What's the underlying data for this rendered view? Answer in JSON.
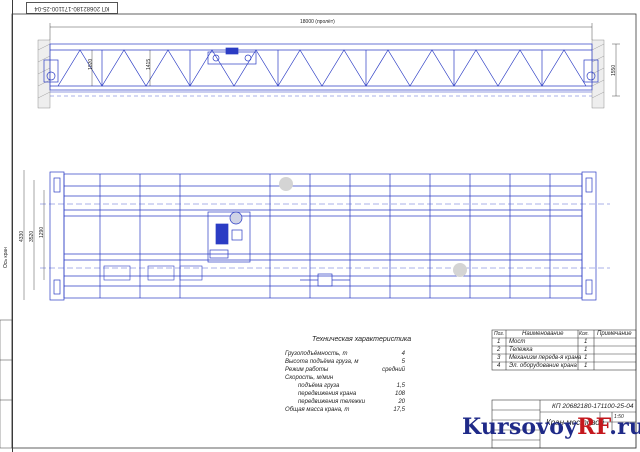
{
  "stamp_code": "КП 20682180-171100-25-04",
  "dimensions": {
    "span": "18000 (пролёт)",
    "left_a": "1020",
    "left_b": "1415",
    "right_height": "1550",
    "plan_a": "4330",
    "plan_b": "3520",
    "plan_c": "1290",
    "side_label": "Ось кран"
  },
  "specs": {
    "title": "Техническая характеристика",
    "rows": [
      {
        "label": "Грузоподъёмность, т",
        "value": "4"
      },
      {
        "label": "Высота подъёма груза, м",
        "value": "5"
      },
      {
        "label": "Режим работы",
        "value": "средний"
      },
      {
        "label": "Скорость, м/мин",
        "value": ""
      },
      {
        "label": "подъёма груза",
        "value": "1,5"
      },
      {
        "label": "передвижения крана",
        "value": "108"
      },
      {
        "label": "передвижения тележки",
        "value": "20"
      },
      {
        "label": "Общая масса крана, т",
        "value": "17,5"
      }
    ]
  },
  "bom": {
    "headers": [
      "Поз.",
      "Наименование",
      "Кол.",
      "Примечание"
    ],
    "rows": [
      {
        "pos": "1",
        "name": "Мост",
        "qty": "1"
      },
      {
        "pos": "2",
        "name": "Тележка",
        "qty": "1"
      },
      {
        "pos": "3",
        "name": "Механизм передв-я крана",
        "qty": "1"
      },
      {
        "pos": "4",
        "name": "Эл. оборудование крана",
        "qty": "1"
      }
    ]
  },
  "title_block": {
    "code": "КП 20682180-171100-25-04",
    "name": "Кран мостовой",
    "sheet": "1:50"
  },
  "watermark": {
    "brand": "Kursovoy",
    "rf": "RF",
    "ru": ".ru"
  },
  "colors": {
    "line": "#2b3cc4",
    "frame": "#3a3a3a",
    "hatch": "#8a8a8a"
  }
}
